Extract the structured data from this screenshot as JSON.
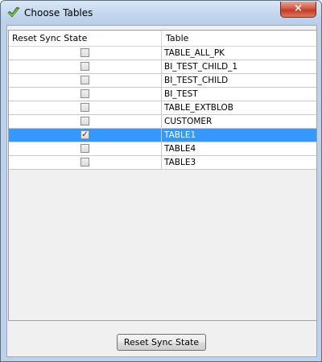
{
  "window": {
    "title": "Choose Tables",
    "close_label": "×"
  },
  "table": {
    "headers": [
      "Reset Sync State",
      "Table"
    ],
    "rows": [
      {
        "checked": false,
        "name": "TABLE_ALL_PK"
      },
      {
        "checked": false,
        "name": "BI_TEST_CHILD_1"
      },
      {
        "checked": false,
        "name": "BI_TEST_CHILD"
      },
      {
        "checked": false,
        "name": "BI_TEST"
      },
      {
        "checked": false,
        "name": "TABLE_EXTBLOB"
      },
      {
        "checked": false,
        "name": "CUSTOMER"
      },
      {
        "checked": true,
        "name": "TABLE1",
        "selected": true
      },
      {
        "checked": false,
        "name": "TABLE4"
      },
      {
        "checked": false,
        "name": "TABLE3"
      }
    ],
    "check_glyph": "✓"
  },
  "footer": {
    "reset_button_label": "Reset Sync State"
  },
  "colors": {
    "selection": "#3399ff",
    "frame": "#bcd2ea",
    "close_button": "#c43b24"
  },
  "icons": {
    "app": "green-check-icon",
    "close": "close-icon"
  }
}
